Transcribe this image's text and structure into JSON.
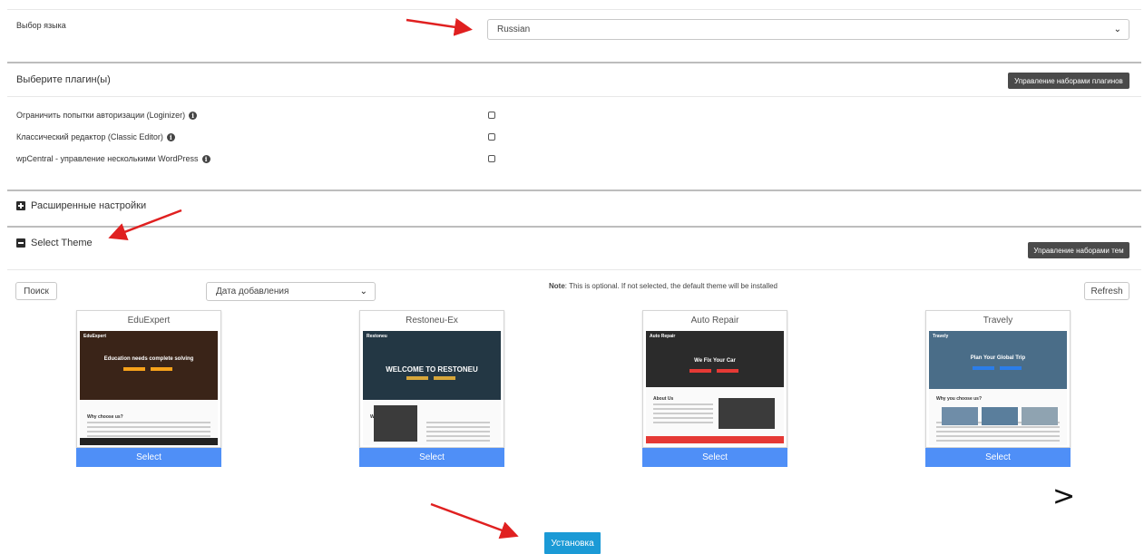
{
  "language": {
    "label": "Выбор языка",
    "selected": "Russian"
  },
  "plugins": {
    "title": "Выберите плагин(ы)",
    "manage_button": "Управление наборами плагинов",
    "items": [
      {
        "label": "Ограничить попытки авторизации (Loginizer)"
      },
      {
        "label": "Классический редактор (Classic Editor)"
      },
      {
        "label": "wpCentral - управление несколькими WordPress"
      }
    ]
  },
  "advanced": {
    "title": "Расширенные настройки"
  },
  "theme": {
    "title": "Select Theme",
    "manage_button": "Управление наборами тем",
    "search_button": "Поиск",
    "sort_selected": "Дата добавления",
    "note_bold": "Note",
    "note_text": ": This is optional. If not selected, the default theme will be installed",
    "refresh_button": "Refresh",
    "select_label": "Select",
    "cards": [
      {
        "name": "EduExpert",
        "shot_brand": "EduExpert",
        "hero_text": "Education needs complete solving",
        "section_text": "Why choose us?",
        "hero_color": "#3a2418",
        "accent": "#f7a21b"
      },
      {
        "name": "Restoneu-Ex",
        "shot_brand": "Restoneu",
        "hero_text": "WELCOME TO RESTONEU",
        "section_text": "Welcome to",
        "hero_color": "#233744",
        "accent": "#d6a63a"
      },
      {
        "name": "Auto Repair",
        "shot_brand": "Auto Repair",
        "hero_text": "We Fix Your Car",
        "section_text": "About Us",
        "hero_color": "#2b2b2b",
        "accent": "#e53935"
      },
      {
        "name": "Travely",
        "shot_brand": "Travely",
        "hero_text": "Plan Your Global Trip",
        "section_text": "Why you choose us?",
        "hero_color": "#4a6d88",
        "accent": "#2b7de9"
      }
    ]
  },
  "next_arrow": ">",
  "install_button": "Установка",
  "annotation_color": "#e02020"
}
